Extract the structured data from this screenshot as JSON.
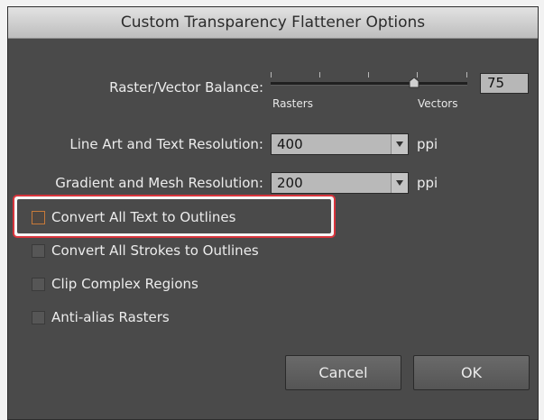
{
  "dialog": {
    "title": "Custom Transparency Flattener Options"
  },
  "raster_vector": {
    "label": "Raster/Vector Balance:",
    "value": "75",
    "left_label": "Rasters",
    "right_label": "Vectors"
  },
  "line_art": {
    "label": "Line Art and Text Resolution:",
    "value": "400",
    "unit": "ppi"
  },
  "gradient_mesh": {
    "label": "Gradient and Mesh Resolution:",
    "value": "200",
    "unit": "ppi"
  },
  "checkboxes": [
    {
      "label": "Convert All Text to Outlines",
      "checked": false
    },
    {
      "label": "Convert All Strokes to Outlines",
      "checked": false
    },
    {
      "label": "Clip Complex Regions",
      "checked": false
    },
    {
      "label": "Anti-alias Rasters",
      "checked": false
    }
  ],
  "buttons": {
    "cancel": "Cancel",
    "ok": "OK"
  },
  "colors": {
    "dialog_bg": "#4a4a4a",
    "highlight": "#d8343c",
    "checkbox_focus": "#c77a3a"
  },
  "icons": {
    "dropdown": "chevron-down-icon"
  }
}
